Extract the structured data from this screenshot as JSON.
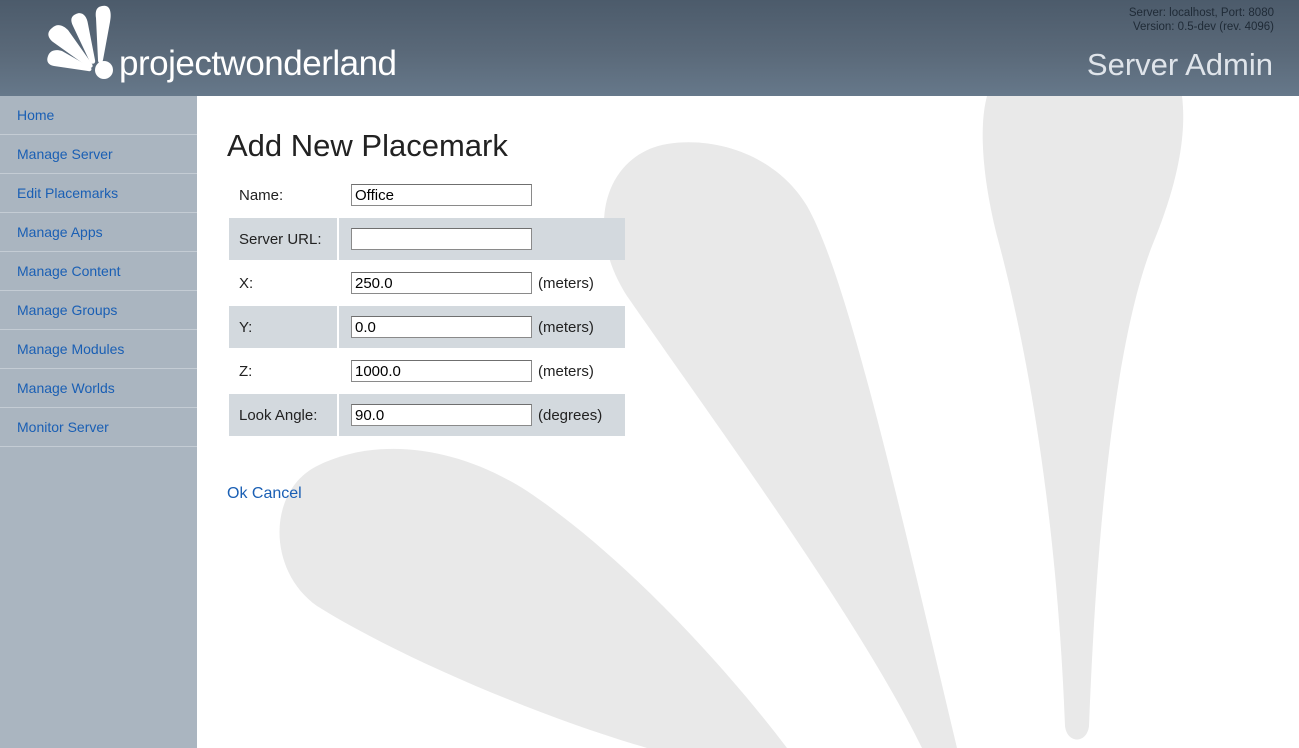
{
  "header": {
    "logo_text": "projectwonderland",
    "server_line": "Server: localhost, Port: 8080",
    "version_line": "Version: 0.5-dev (rev. 4096)",
    "title": "Server Admin"
  },
  "sidebar": {
    "items": [
      {
        "label": "Home"
      },
      {
        "label": "Manage Server"
      },
      {
        "label": "Edit Placemarks"
      },
      {
        "label": "Manage Apps"
      },
      {
        "label": "Manage Content"
      },
      {
        "label": "Manage Groups"
      },
      {
        "label": "Manage Modules"
      },
      {
        "label": "Manage Worlds"
      },
      {
        "label": "Monitor Server"
      }
    ]
  },
  "main": {
    "title": "Add New Placemark",
    "fields": [
      {
        "label": "Name:",
        "value": "Office",
        "unit": ""
      },
      {
        "label": "Server URL:",
        "value": "",
        "unit": ""
      },
      {
        "label": "X:",
        "value": "250.0",
        "unit": "(meters)"
      },
      {
        "label": "Y:",
        "value": "0.0",
        "unit": "(meters)"
      },
      {
        "label": "Z:",
        "value": "1000.0",
        "unit": "(meters)"
      },
      {
        "label": "Look Angle:",
        "value": "90.0",
        "unit": "(degrees)"
      }
    ],
    "ok_label": "Ok",
    "cancel_label": "Cancel"
  },
  "colors": {
    "header": "#5a6979",
    "sidebar": "#aab5c0",
    "link": "#1a5fb4",
    "row_alt": "#d3d9de"
  }
}
